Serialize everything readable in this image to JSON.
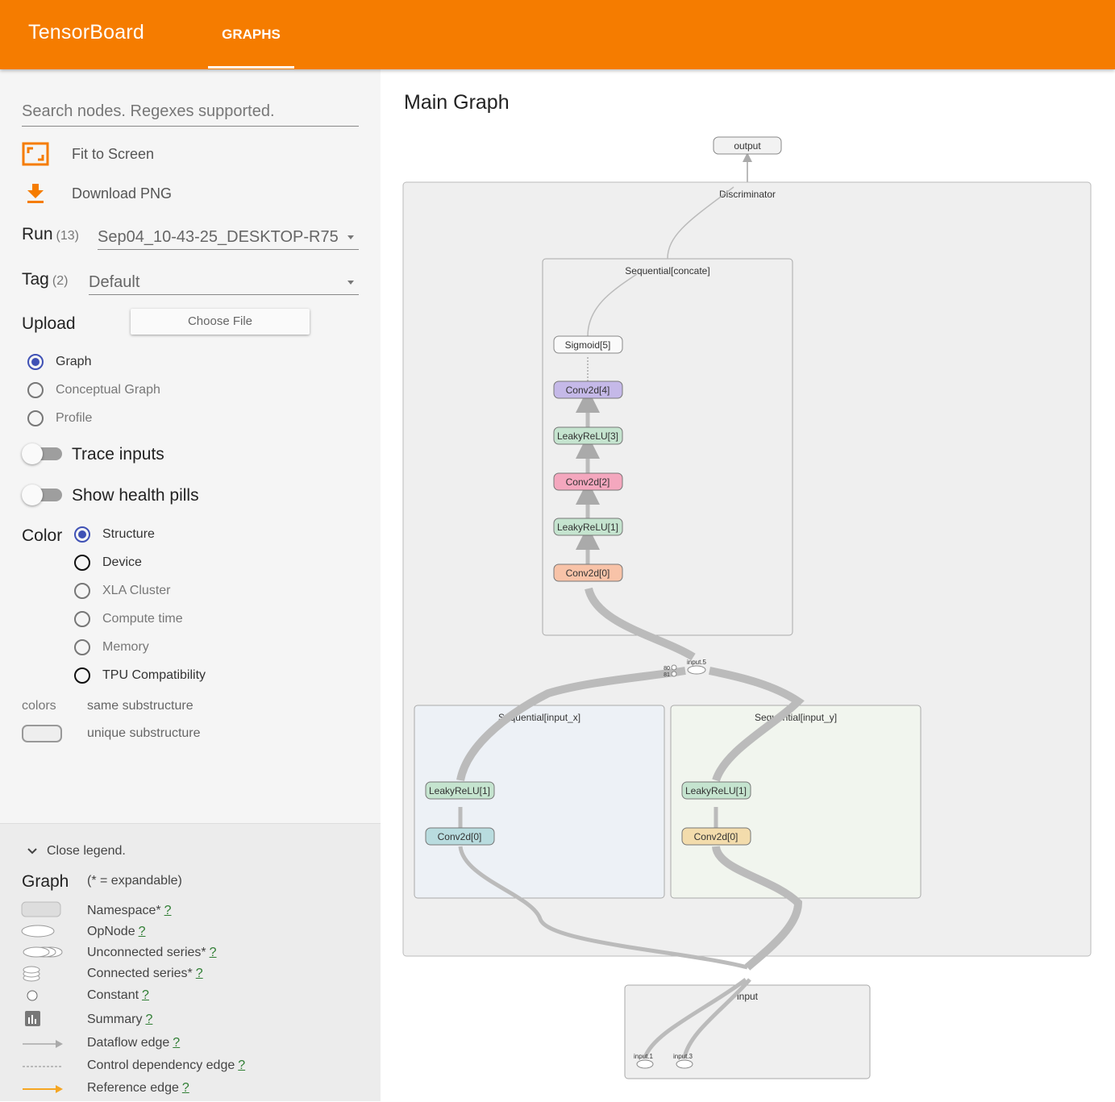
{
  "header": {
    "brand": "TensorBoard",
    "tab_graphs": "GRAPHS"
  },
  "sidebar": {
    "search_placeholder": "Search nodes. Regexes supported.",
    "fit_label": "Fit to Screen",
    "download_label": "Download PNG",
    "run_label": "Run",
    "run_count": "(13)",
    "run_value": "Sep04_10-43-25_DESKTOP-R75",
    "tag_label": "Tag",
    "tag_count": "(2)",
    "tag_value": "Default",
    "upload_label": "Upload",
    "choose_file": "Choose File",
    "graph_type": [
      "Graph",
      "Conceptual Graph",
      "Profile"
    ],
    "trace_inputs": "Trace inputs",
    "health_pills": "Show health pills",
    "color_label": "Color",
    "color_options": [
      "Structure",
      "Device",
      "XLA Cluster",
      "Compute time",
      "Memory",
      "TPU Compatibility"
    ],
    "colors_label": "colors",
    "same_sub": "same substructure",
    "unique_sub": "unique substructure"
  },
  "legend": {
    "close": "Close legend.",
    "graph": "Graph",
    "expandable": "(* = expandable)",
    "help": "?",
    "items": [
      "Namespace*",
      "OpNode",
      "Unconnected series*",
      "Connected series*",
      "Constant",
      "Summary",
      "Dataflow edge",
      "Control dependency edge",
      "Reference edge"
    ]
  },
  "main": {
    "title": "Main Graph",
    "nodes": {
      "output": "output",
      "discriminator": "Discriminator",
      "seq_concate": "Sequential[concate]",
      "sigmoid": "Sigmoid[5]",
      "conv4": "Conv2d[4]",
      "leaky3": "LeakyReLU[3]",
      "conv2": "Conv2d[2]",
      "leaky1": "LeakyReLU[1]",
      "conv0": "Conv2d[0]",
      "input5": "input.5",
      "c80": "80",
      "c81": "81",
      "seq_x": "Sequential[input_x]",
      "seq_y": "Sequential[input_y]",
      "x_leaky": "LeakyReLU[1]",
      "x_conv": "Conv2d[0]",
      "y_leaky": "LeakyReLU[1]",
      "y_conv": "Conv2d[0]",
      "input": "input",
      "input1": "input.1",
      "input3": "input.3"
    },
    "colors": {
      "accent": "#f57c00",
      "conv4": "#c5b9e8",
      "leaky": "#c5e4cf",
      "conv2": "#f4a7be",
      "conv0": "#f8c3a8",
      "x_conv": "#b9dcdf",
      "y_conv": "#f3dcac",
      "seq_x_bg": "#edf1f6",
      "seq_y_bg": "#f1f5ee"
    }
  }
}
